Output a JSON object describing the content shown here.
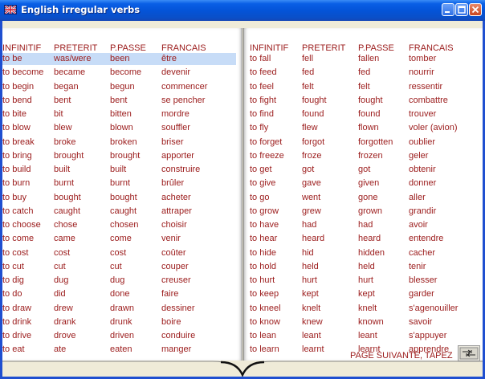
{
  "window": {
    "title": "English irregular verbs"
  },
  "headers": [
    "INFINITIF",
    "PRETERIT",
    "P.PASSE",
    "FRANCAIS"
  ],
  "left_rows": [
    [
      "to be",
      "was/were",
      "been",
      "être"
    ],
    [
      "to become",
      "became",
      "become",
      "devenir"
    ],
    [
      "to begin",
      "began",
      "begun",
      "commencer"
    ],
    [
      "to bend",
      "bent",
      "bent",
      "se pencher"
    ],
    [
      "to bite",
      "bit",
      "bitten",
      "mordre"
    ],
    [
      "to blow",
      "blew",
      "blown",
      "souffler"
    ],
    [
      "to break",
      "broke",
      "broken",
      "briser"
    ],
    [
      "to bring",
      "brought",
      "brought",
      "apporter"
    ],
    [
      "to build",
      "built",
      "built",
      "construire"
    ],
    [
      "to burn",
      "burnt",
      "burnt",
      "brûler"
    ],
    [
      "to buy",
      "bought",
      "bought",
      "acheter"
    ],
    [
      "to catch",
      "caught",
      "caught",
      "attraper"
    ],
    [
      "to choose",
      "chose",
      "chosen",
      "choisir"
    ],
    [
      "to come",
      "came",
      "come",
      "venir"
    ],
    [
      "to cost",
      "cost",
      "cost",
      "coûter"
    ],
    [
      "to cut",
      "cut",
      "cut",
      "couper"
    ],
    [
      "to dig",
      "dug",
      "dug",
      "creuser"
    ],
    [
      "to do",
      "did",
      "done",
      "faire"
    ],
    [
      "to draw",
      "drew",
      "drawn",
      "dessiner"
    ],
    [
      "to drink",
      "drank",
      "drunk",
      "boire"
    ],
    [
      "to drive",
      "drove",
      "driven",
      "conduire"
    ],
    [
      "to eat",
      "ate",
      "eaten",
      "manger"
    ]
  ],
  "right_rows": [
    [
      "to fall",
      "fell",
      "fallen",
      "tomber"
    ],
    [
      "to feed",
      "fed",
      "fed",
      "nourrir"
    ],
    [
      "to feel",
      "felt",
      "felt",
      "ressentir"
    ],
    [
      "to fight",
      "fought",
      "fought",
      "combattre"
    ],
    [
      "to find",
      "found",
      "found",
      "trouver"
    ],
    [
      "to fly",
      "flew",
      "flown",
      "voler (avion)"
    ],
    [
      "to forget",
      "forgot",
      "forgotten",
      "oublier"
    ],
    [
      "to freeze",
      "froze",
      "frozen",
      "geler"
    ],
    [
      "to get",
      "got",
      "got",
      "obtenir"
    ],
    [
      "to give",
      "gave",
      "given",
      "donner"
    ],
    [
      "to go",
      "went",
      "gone",
      "aller"
    ],
    [
      "to grow",
      "grew",
      "grown",
      "grandir"
    ],
    [
      "to have",
      "had",
      "had",
      "avoir"
    ],
    [
      "to hear",
      "heard",
      "heard",
      "entendre"
    ],
    [
      "to hide",
      "hid",
      "hidden",
      "cacher"
    ],
    [
      "to hold",
      "held",
      "held",
      "tenir"
    ],
    [
      "to hurt",
      "hurt",
      "hurt",
      "blesser"
    ],
    [
      "to keep",
      "kept",
      "kept",
      "garder"
    ],
    [
      "to kneel",
      "knelt",
      "knelt",
      "s'agenouiller"
    ],
    [
      "to know",
      "knew",
      "known",
      "savoir"
    ],
    [
      "to lean",
      "leant",
      "leant",
      "s'appuyer"
    ],
    [
      "to learn",
      "learnt",
      "learnt",
      "apprendre"
    ]
  ],
  "footer": {
    "text": "PAGE SUIVANTE,   TAPEZ"
  },
  "colors": {
    "text": "#9b1b1b",
    "highlight": "#c7dcf7",
    "titlebar": "#0454d8",
    "chrome": "#efebd8"
  },
  "icons": {
    "app": "uk-flag-icon",
    "next": "tab-key-icon"
  }
}
